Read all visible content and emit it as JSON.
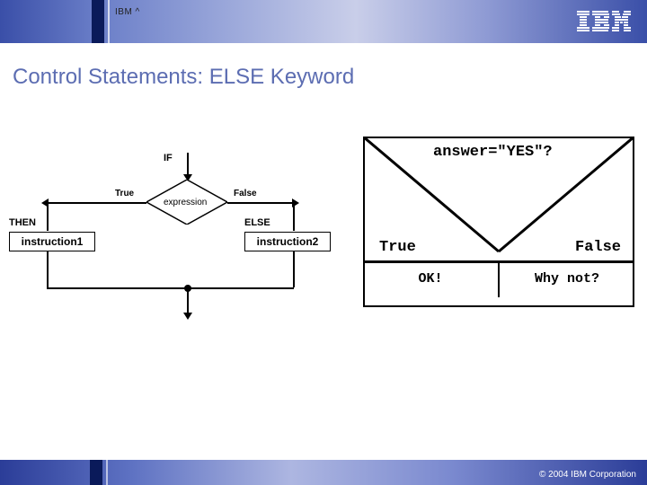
{
  "header": {
    "brand_small": "IBM ^",
    "logo_alt": "IBM"
  },
  "title": "Control Statements: ELSE Keyword",
  "flowchart": {
    "if_label": "IF",
    "true_label": "True",
    "false_label": "False",
    "expression_label": "expression",
    "then_label": "THEN",
    "else_label": "ELSE",
    "instruction1": "instruction1",
    "instruction2": "instruction2"
  },
  "right_diagram": {
    "question": "answer=\"YES\"?",
    "true_label": "True",
    "false_label": "False",
    "ok_label": "OK!",
    "whynot_label": "Why not?"
  },
  "footer": {
    "copyright": "© 2004 IBM Corporation"
  }
}
